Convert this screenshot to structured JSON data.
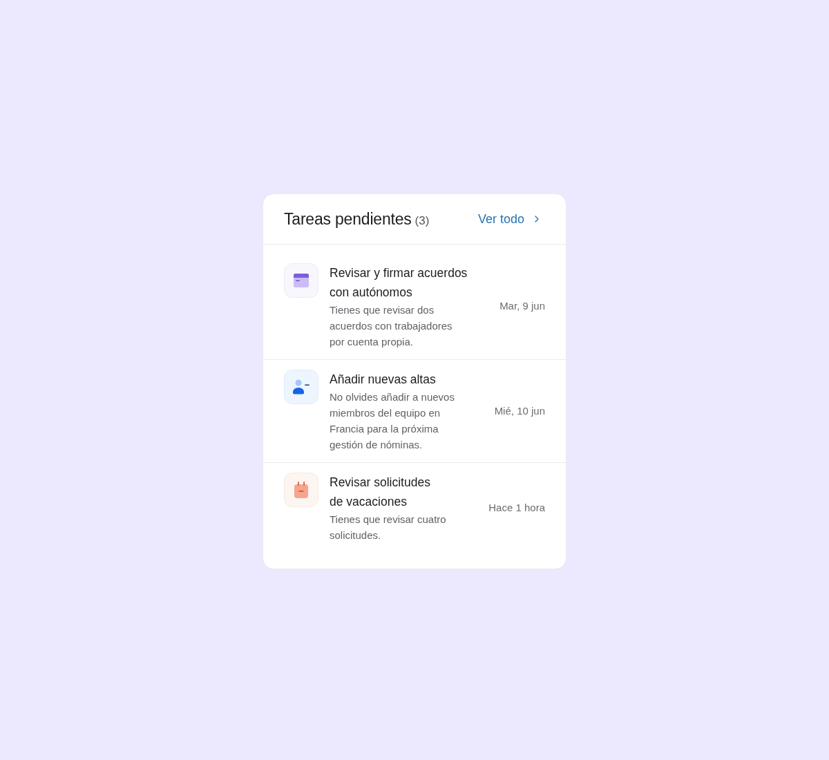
{
  "header": {
    "title": "Tareas pendientes",
    "count": "(3)",
    "link": "Ver todo"
  },
  "tasks": [
    {
      "kind": "document",
      "title": "Revisar y firmar acuerdos\ncon autónomos",
      "description": "Tienes que revisar dos acuerdos con trabajadores por cuenta propia.",
      "date": "Mar, 9 jun"
    },
    {
      "kind": "person",
      "title": "Añadir nuevas altas",
      "description": "No olvides añadir a nuevos miembros del equipo en Francia para la próxima gestión de nóminas.",
      "date": "Mié, 10 jun"
    },
    {
      "kind": "calendar",
      "title": "Revisar solicitudes\nde vacaciones",
      "description": "Tienes que revisar cuatro solicitudes.",
      "date": "Hace 1 hora"
    }
  ]
}
